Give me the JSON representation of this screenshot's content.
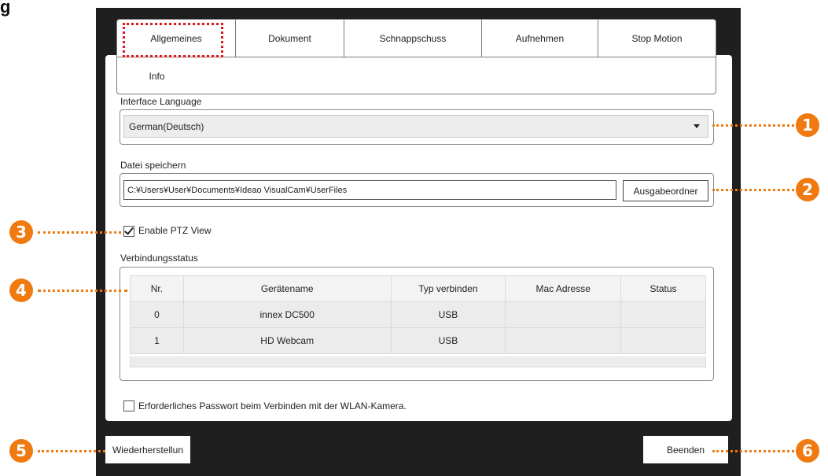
{
  "figure_label": "g",
  "tabs": [
    {
      "label": "Allgemeines"
    },
    {
      "label": "Dokument"
    },
    {
      "label": "Schnappschuss"
    },
    {
      "label": "Aufnehmen"
    },
    {
      "label": "Stop Motion"
    },
    {
      "label": "Info"
    }
  ],
  "language": {
    "label": "Interface Language",
    "selected": "German(Deutsch)"
  },
  "save": {
    "label": "Datei speichern",
    "path": "C:¥Users¥User¥Documents¥Ideao VisualCam¥UserFiles",
    "button": "Ausgabeordner"
  },
  "ptz": {
    "label": "Enable PTZ View",
    "checked": true
  },
  "connection": {
    "label": "Verbindungsstatus",
    "columns": [
      "Nr.",
      "Gerätename",
      "Typ verbinden",
      "Mac Adresse",
      "Status"
    ],
    "rows": [
      [
        "0",
        "innex DC500",
        "USB",
        "",
        ""
      ],
      [
        "1",
        "HD Webcam",
        "USB",
        "",
        ""
      ]
    ]
  },
  "password": {
    "label": "Erforderliches Passwort beim Verbinden mit der WLAN-Kamera.",
    "checked": false
  },
  "buttons": {
    "restore": "Wiederherstellun",
    "exit": "Beenden"
  },
  "callouts": [
    "1",
    "2",
    "3",
    "4",
    "5",
    "6"
  ],
  "colors": {
    "callout": "#f07a10",
    "highlight": "#e01818",
    "frame": "#1f1f1f"
  }
}
